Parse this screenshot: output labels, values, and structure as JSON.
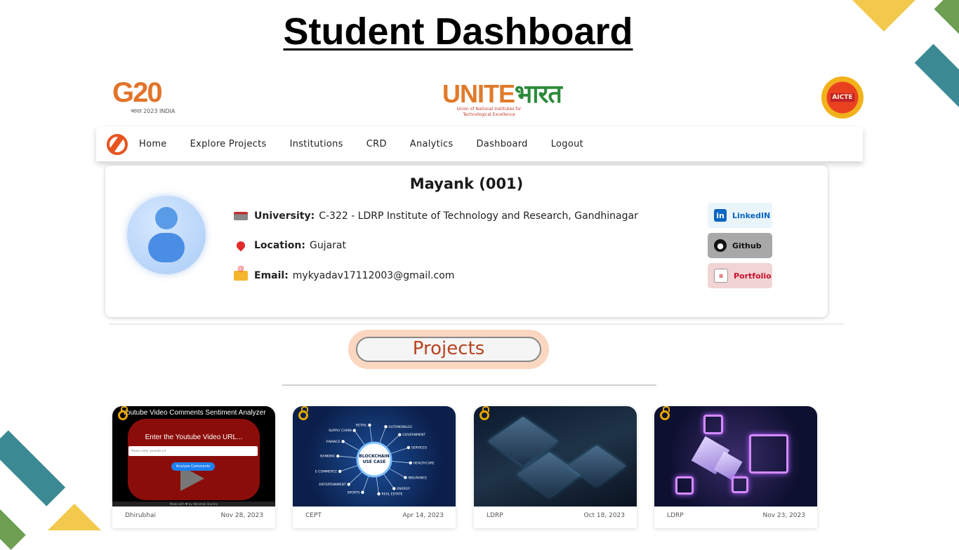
{
  "slide_title": "Student Dashboard",
  "logos": {
    "g20_text": "G20",
    "g20_sub": "भारत 2023 INDIA",
    "unite_text_a": "UNITE",
    "unite_text_b": "भारत",
    "unite_sub": "Union of National Institutes for Technological Excellence",
    "aicte_text": "AICTE"
  },
  "nav": {
    "items": [
      "Home",
      "Explore Projects",
      "Institutions",
      "CRD",
      "Analytics",
      "Dashboard",
      "Logout"
    ]
  },
  "profile": {
    "name": "Mayank (001)",
    "university_label": "University:",
    "university_value": "C-322 - LDRP Institute of Technology and Research, Gandhinagar",
    "location_label": "Location:",
    "location_value": "Gujarat",
    "email_label": "Email:",
    "email_value": "mykyadav17112003@gmail.com",
    "links": {
      "linkedin": "LinkedIN",
      "github": "Github",
      "portfolio": "Portfolio"
    }
  },
  "projects_heading": "Projects",
  "projects": [
    {
      "thumb_title": "Youtube Video Comments Sentiment Analyzer",
      "thumb_prompt": "Enter the Youtube Video URL...",
      "thumb_input_placeholder": "Please enter youtube url",
      "thumb_button": "Analyze Comments",
      "thumb_credit": "Made with ♥ by Abhishek Sharma",
      "institution": "Dhirubhai",
      "date": "Nov 28, 2023"
    },
    {
      "thumb_center": [
        "BLOCKCHAIN",
        "USE CASE"
      ],
      "thumb_labels": [
        "RETAIL",
        "AUTOMOBILES",
        "GOVERNMENT",
        "SERVICES",
        "HEALTHCARE",
        "INSURANCE",
        "ENERGY",
        "REAL ESTATE",
        "SPORTS",
        "ENTERTAINMENT",
        "E-COMMERCE",
        "BANKING",
        "FINANCE",
        "SUPPLY CHAIN"
      ],
      "institution": "CEPT",
      "date": "Apr 14, 2023"
    },
    {
      "institution": "LDRP",
      "date": "Oct 18, 2023"
    },
    {
      "institution": "LDRP",
      "date": "Nov 23, 2023"
    }
  ],
  "colors": {
    "accent_orange": "#e8541f",
    "projects_text": "#b7431f",
    "linkedin": "#0a66c2",
    "portfolio": "#c8102e"
  }
}
